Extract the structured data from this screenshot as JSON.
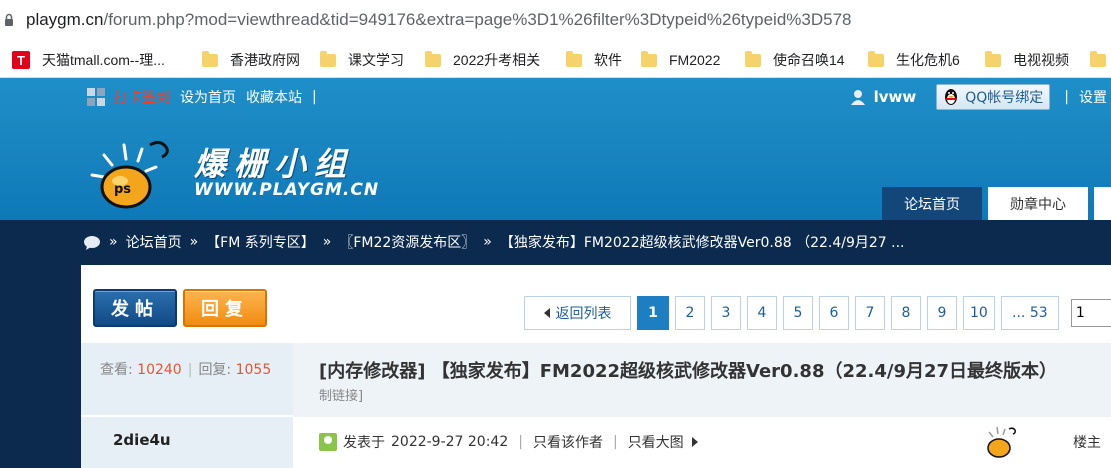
{
  "browser": {
    "url_host": "playgm.cn",
    "url_rest": "/forum.php?mod=viewthread&tid=949176&extra=page%3D1%26filter%3Dtypeid%26typeid%3D578"
  },
  "bookmarks": [
    {
      "label": "天猫tmall.com--理...",
      "icon": "tmall-icon"
    },
    {
      "label": "香港政府网",
      "icon": "folder-icon"
    },
    {
      "label": "课文学习",
      "icon": "folder-icon"
    },
    {
      "label": "2022升考相关",
      "icon": "folder-icon"
    },
    {
      "label": "软件",
      "icon": "folder-icon"
    },
    {
      "label": "FM2022",
      "icon": "folder-icon"
    },
    {
      "label": "使命召唤14",
      "icon": "folder-icon"
    },
    {
      "label": "生化危机6",
      "icon": "folder-icon"
    },
    {
      "label": "电视视频",
      "icon": "folder-icon"
    }
  ],
  "tmall_glyph": "T",
  "header": {
    "checkin": "打卡签到",
    "set_home": "设为首页",
    "bookmark": "收藏本站",
    "divider": "|",
    "username": "lvww",
    "qq_bind": "QQ帐号绑定",
    "settings": "设置",
    "logo_cn": "爆栅小组",
    "logo_en": "WWW.PLAYGM.CN",
    "logo_badge": "ps"
  },
  "nav": {
    "home": "论坛首页",
    "medals": "勋章中心"
  },
  "breadcrumb": {
    "arrow": "»",
    "items": [
      "论坛首页",
      "【FM 系列专区】",
      "〖FM22资源发布区〗",
      "【独家发布】FM2022超级核武修改器Ver0.88 （22.4/9月27 ..."
    ]
  },
  "actions": {
    "post": "发帖",
    "reply": "回复"
  },
  "pager": {
    "back": "返回列表",
    "pages": [
      "1",
      "2",
      "3",
      "4",
      "5",
      "6",
      "7",
      "8",
      "9",
      "10"
    ],
    "current": "1",
    "more": "... 53",
    "input_value": "1"
  },
  "thread": {
    "views_label": "查看:",
    "views": "10240",
    "replies_label": "回复:",
    "replies": "1055",
    "stat_sep": "|",
    "title": "[内存修改器] 【独家发布】FM2022超级核武修改器Ver0.88（22.4/9月27日最终版本）",
    "permalink": "制链接]",
    "author": "2die4u",
    "posted_label": "发表于",
    "posted_time": "2022-9-27 20:42",
    "pipe": "|",
    "only_author": "只看该作者",
    "only_images": "只看大图",
    "floor": "楼主"
  }
}
